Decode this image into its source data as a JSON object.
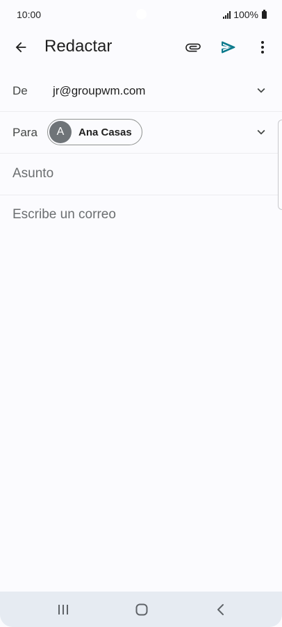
{
  "status_bar": {
    "time": "10:00",
    "battery": "100%"
  },
  "app_bar": {
    "title": "Redactar",
    "icons": [
      "arrow-back-icon",
      "attach-icon",
      "send-icon",
      "more-vert-icon"
    ]
  },
  "compose": {
    "from_label": "De",
    "from_value": "jr@groupwm.com",
    "to_label": "Para",
    "recipient": {
      "initial": "A",
      "name": "Ana Casas"
    },
    "subject_placeholder": "Asunto",
    "body_placeholder": "Escribe un correo"
  },
  "nav_bar": {
    "icons": [
      "recents-icon",
      "home-icon",
      "nav-back-icon"
    ]
  },
  "colors": {
    "background": "#fbfbfe",
    "send_accent": "#0b7a8c",
    "avatar": "#6f7478",
    "nav_bar": "#e6ebf2"
  }
}
